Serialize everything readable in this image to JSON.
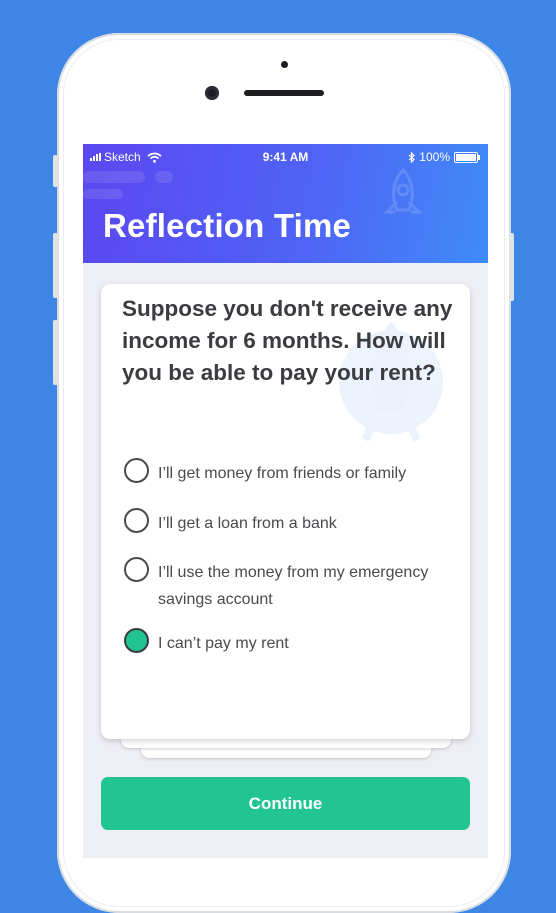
{
  "colors": {
    "background": "#3d86e6",
    "header_gradient_start": "#5b47f0",
    "header_gradient_end": "#3f8bf8",
    "accent_green": "#22c492"
  },
  "status_bar": {
    "carrier": "Sketch",
    "time": "9:41 AM",
    "battery": "100%",
    "icons": [
      "signal-bars-icon",
      "wifi-icon",
      "bluetooth-icon",
      "battery-icon"
    ]
  },
  "header": {
    "title": "Reflection Time"
  },
  "question": {
    "text": "Suppose you don't receive any income for 6 months. How will you be able to pay your rent?",
    "options": [
      {
        "label": "I’ll get money from friends or family",
        "selected": false
      },
      {
        "label": "I’ll get a loan from a bank",
        "selected": false
      },
      {
        "label": "I’ll use the money from my emergency savings account",
        "selected": false
      },
      {
        "label": "I can’t pay my rent",
        "selected": true
      }
    ]
  },
  "continue_button": {
    "label": "Continue"
  }
}
